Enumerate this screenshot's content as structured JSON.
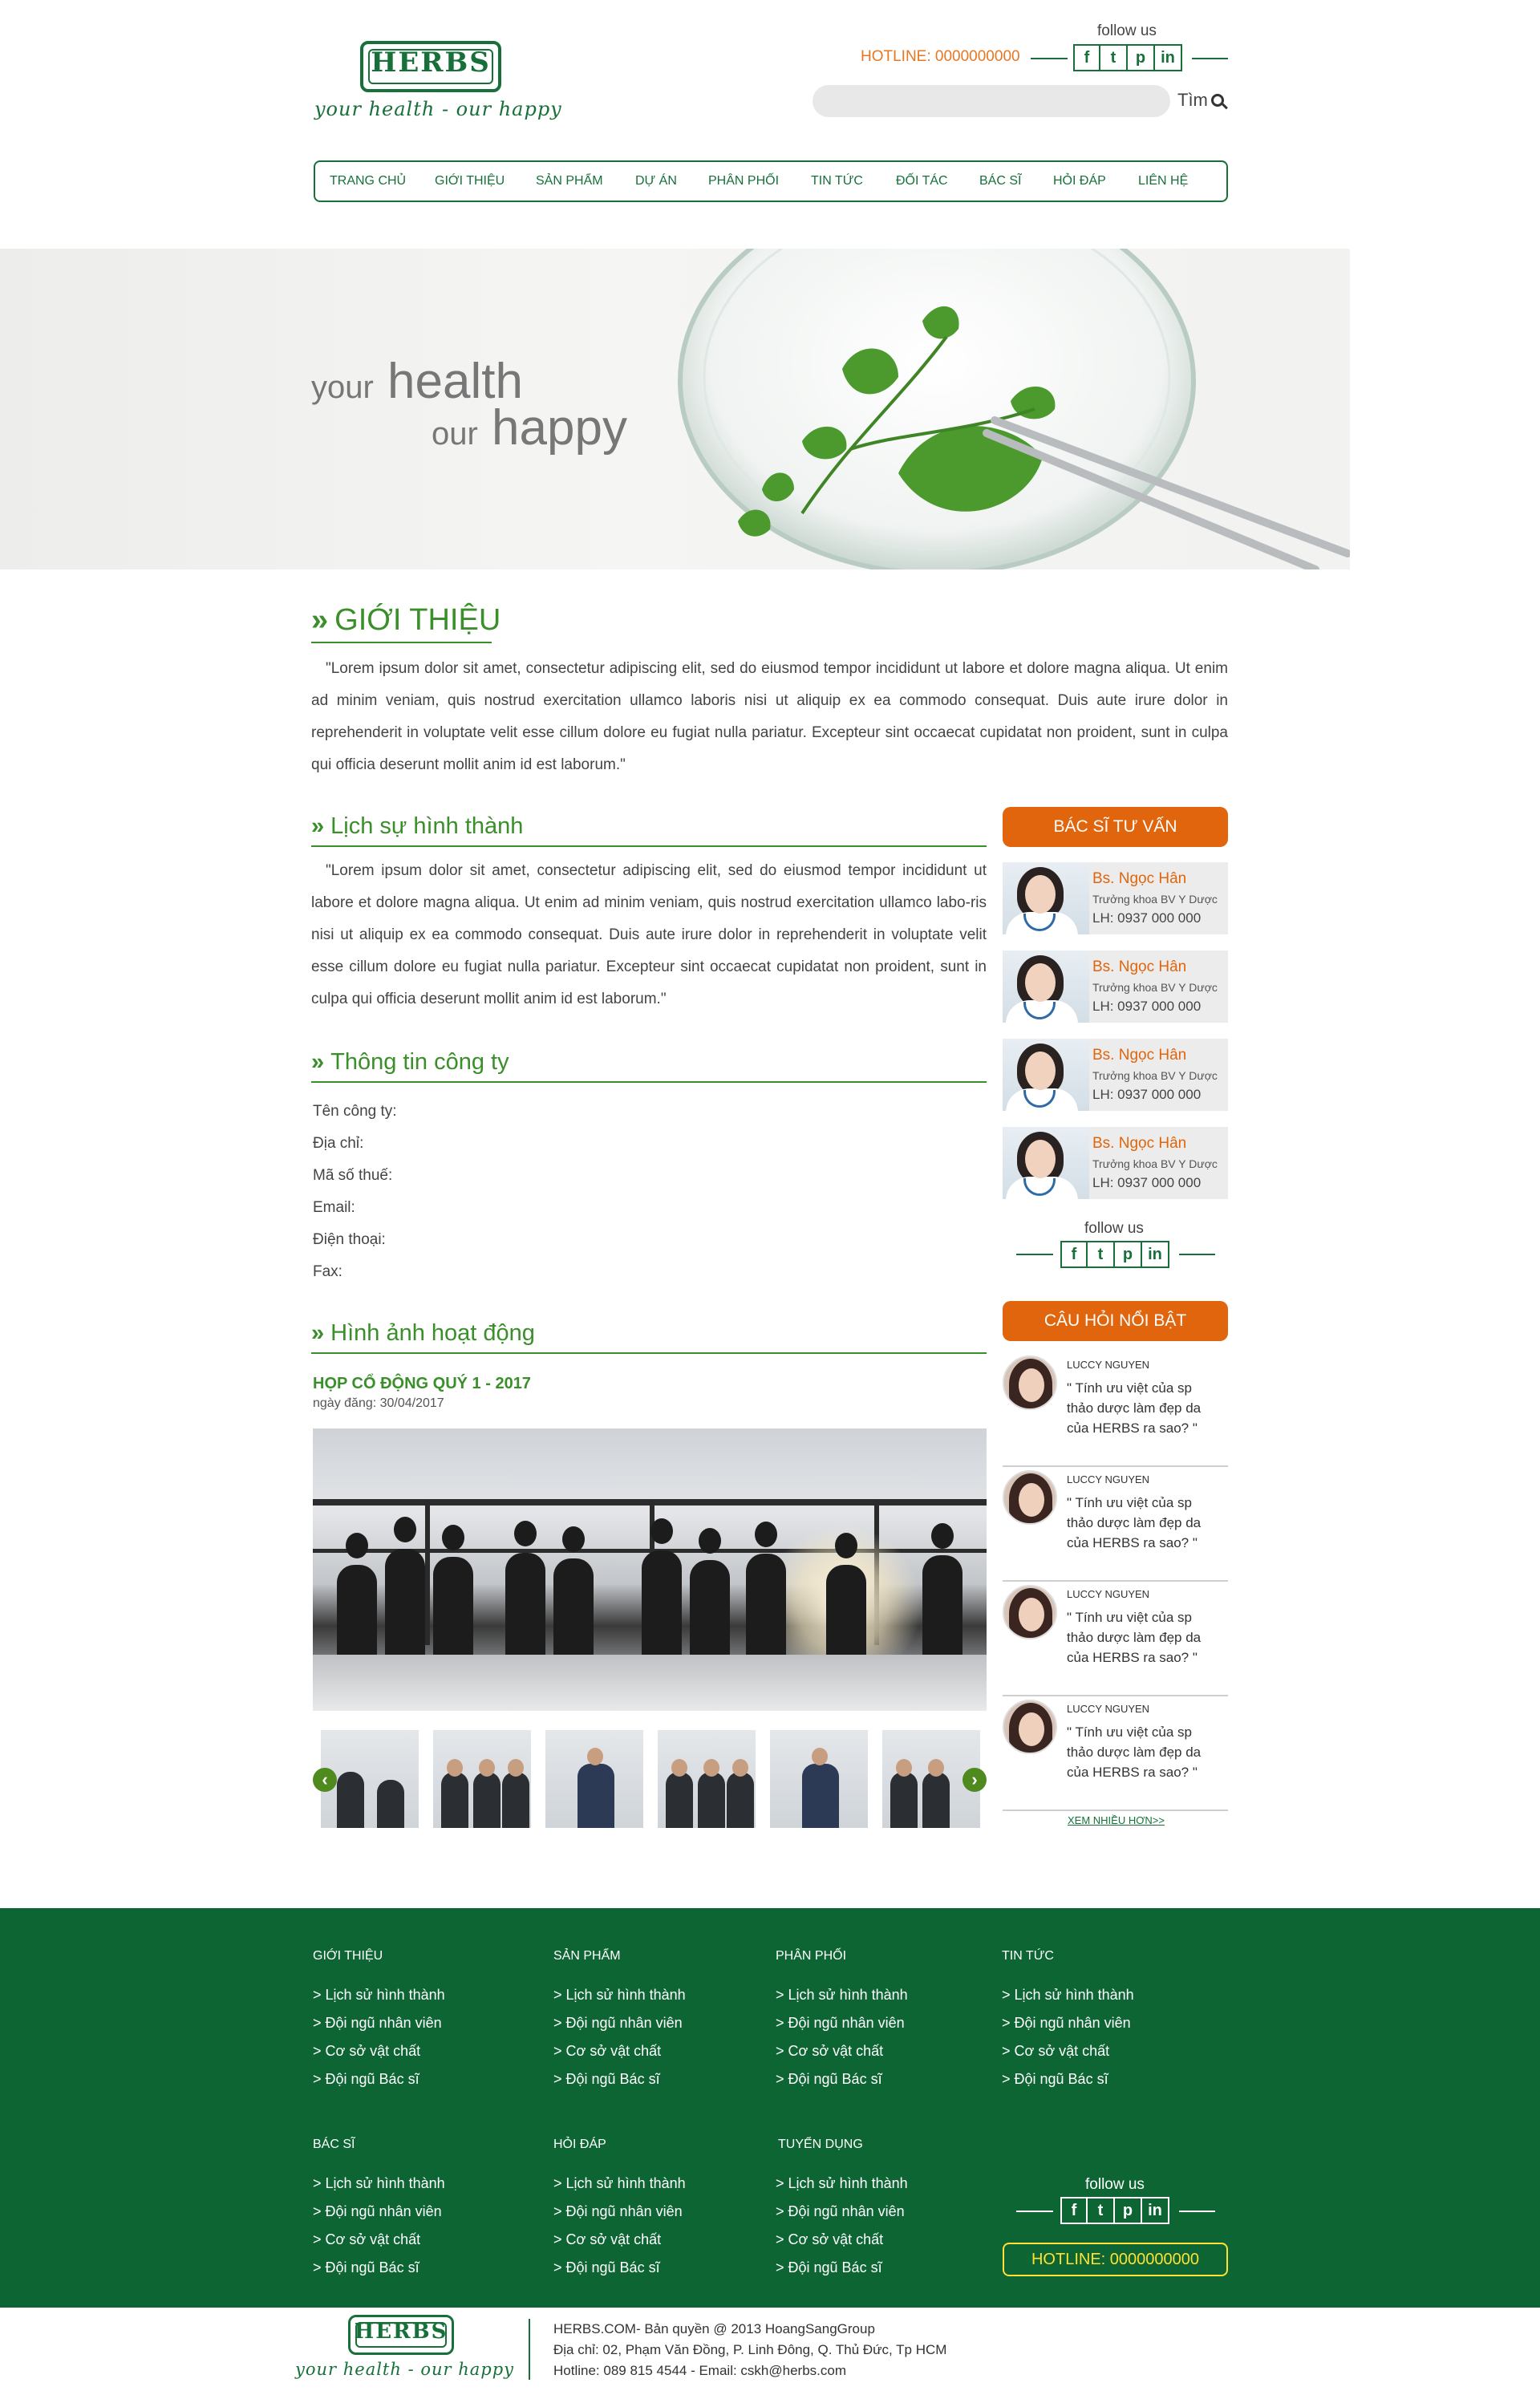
{
  "brand": {
    "logo_text": "HERBS",
    "slogan": "your health - our happy"
  },
  "header": {
    "follow_label": "follow us",
    "hotline": "HOTLINE: 0000000000",
    "search_placeholder": "",
    "search_button": "Tìm",
    "social": [
      "f",
      "t",
      "p",
      "in"
    ]
  },
  "nav": {
    "items": [
      "TRANG CHỦ",
      "GIỚI THIỆU",
      "SẢN PHẨM",
      "DỰ ÁN",
      "PHÂN PHỐI",
      "TIN TỨC",
      "ĐỐI TÁC",
      "BÁC SĨ",
      "HỎI ĐÁP",
      "LIÊN HỆ"
    ]
  },
  "banner": {
    "line1_small": "your",
    "line1_big": "health",
    "line2_small": "our",
    "line2_big": "happy"
  },
  "intro": {
    "title": "GIỚI THIỆU",
    "text": "\"Lorem ipsum dolor sit amet, consectetur adipiscing elit, sed do eiusmod tempor incididunt ut labore et dolore magna aliqua. Ut enim ad minim veniam, quis nostrud exercitation ullamco laboris nisi ut aliquip ex ea commodo consequat. Duis aute irure dolor in reprehenderit in voluptate velit esse cillum dolore eu fugiat nulla pariatur. Excepteur sint occaecat cupidatat non proident, sunt in culpa qui officia deserunt mollit anim id est laborum.\""
  },
  "history": {
    "title": "Lịch sự hình thành",
    "text": "\"Lorem ipsum dolor sit amet, consectetur adipiscing elit, sed do eiusmod tempor incididunt ut labore et dolore magna aliqua. Ut enim ad minim veniam, quis nostrud exercitation ullamco labo-ris nisi ut aliquip ex ea commodo consequat. Duis aute irure dolor in reprehenderit in voluptate velit esse cillum dolore eu fugiat nulla pariatur. Excepteur sint occaecat cupidatat non proident, sunt in culpa qui officia deserunt mollit anim id est laborum.\""
  },
  "company": {
    "title": "Thông tin công ty",
    "fields": [
      "Tên công ty:",
      "Địa chỉ:",
      "Mã số thuế:",
      "Email:",
      "Điện thoại:",
      "Fax:"
    ]
  },
  "activities": {
    "title": "Hình ảnh hoạt động",
    "event_title": "HỌP CỔ ĐỘNG QUÝ 1 - 2017",
    "event_date": "ngày đăng: 30/04/2017",
    "thumb_count": 6
  },
  "sidebar": {
    "doctors_title": "BÁC SĨ TƯ VẤN",
    "doctors": [
      {
        "name": "Bs. Ngọc Hân",
        "role": "Trưởng khoa BV Y Dược",
        "phone": "LH: 0937 000 000"
      },
      {
        "name": "Bs. Ngọc Hân",
        "role": "Trưởng khoa BV Y Dược",
        "phone": "LH: 0937 000 000"
      },
      {
        "name": "Bs. Ngọc Hân",
        "role": "Trưởng khoa BV Y Dược",
        "phone": "LH: 0937 000 000"
      },
      {
        "name": "Bs. Ngọc Hân",
        "role": "Trưởng khoa BV Y Dược",
        "phone": "LH: 0937 000 000"
      }
    ],
    "follow_label": "follow us",
    "questions_title": "CÂU HỎI NỔI BẬT",
    "questions": [
      {
        "name": "LUCCY NGUYEN",
        "text": "\" Tính ưu việt của sp thảo dược làm đẹp da của HERBS ra sao? \""
      },
      {
        "name": "LUCCY NGUYEN",
        "text": "\" Tính ưu việt của sp thảo dược làm đẹp da của HERBS ra sao? \""
      },
      {
        "name": "LUCCY NGUYEN",
        "text": "\" Tính ưu việt của sp thảo dược làm đẹp da của HERBS ra sao? \""
      },
      {
        "name": "LUCCY NGUYEN",
        "text": "\" Tính ưu việt của sp thảo dược làm đẹp da của HERBS ra sao? \""
      }
    ],
    "more_link": "XEM NHIỀU HƠN>>"
  },
  "footer": {
    "columns": [
      {
        "title": "GIỚI THIỆU",
        "links": [
          "> Lịch sử hình thành",
          "> Đội ngũ nhân viên",
          "> Cơ sở vật chất",
          "> Đội ngũ Bác sĩ"
        ]
      },
      {
        "title": "SẢN PHẨM",
        "links": [
          "> Lịch sử hình thành",
          "> Đội ngũ nhân viên",
          "> Cơ sở vật chất",
          "> Đội ngũ Bác sĩ"
        ]
      },
      {
        "title": "PHÂN PHỐI",
        "links": [
          "> Lịch sử hình thành",
          "> Đội ngũ nhân viên",
          "> Cơ sở vật chất",
          "> Đội ngũ Bác sĩ"
        ]
      },
      {
        "title": "TIN TỨC",
        "links": [
          "> Lịch sử hình thành",
          "> Đội ngũ nhân viên",
          "> Cơ sở vật chất",
          "> Đội ngũ Bác sĩ"
        ]
      },
      {
        "title": "BÁC SĨ",
        "links": [
          "> Lịch sử hình thành",
          "> Đội ngũ nhân viên",
          "> Cơ sở vật chất",
          "> Đội ngũ Bác sĩ"
        ]
      },
      {
        "title": "HỎI ĐÁP",
        "links": [
          "> Lịch sử hình thành",
          "> Đội ngũ nhân viên",
          "> Cơ sở vật chất",
          "> Đội ngũ Bác sĩ"
        ]
      },
      {
        "title": "TUYỂN DỤNG",
        "links": [
          "> Lịch sử hình thành",
          "> Đội ngũ nhân viên",
          "> Cơ sở vật chất",
          "> Đội ngũ Bác sĩ"
        ]
      }
    ],
    "follow_label": "follow us",
    "hotline": "HOTLINE: 0000000000"
  },
  "bottom": {
    "copyright": "HERBS.COM- Bản quyền @ 2013 HoangSangGroup",
    "address": "Địa chỉ: 02, Phạm Văn Đồng, P. Linh Đông, Q. Thủ Đức, Tp HCM",
    "contact": "Hotline: 089 815 4544 - Email: cskh@herbs.com"
  },
  "colors": {
    "brand_green": "#17703a",
    "heading_green": "#3a8f2a",
    "accent_orange": "#e0650c",
    "footer_green": "#0d6534",
    "hotline_yellow": "#ffe033"
  }
}
